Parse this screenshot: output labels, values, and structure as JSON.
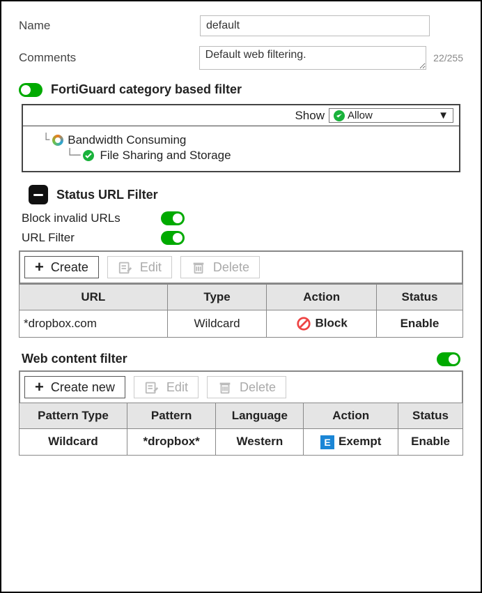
{
  "form": {
    "name_label": "Name",
    "name_value": "default",
    "comments_label": "Comments",
    "comments_value": "Default web filtering.",
    "comments_counter": "22/255"
  },
  "fortiguard": {
    "title": "FortiGuard category based filter",
    "show_label": "Show",
    "show_selected": "Allow",
    "tree_parent": "Bandwidth Consuming",
    "tree_child": "File Sharing and Storage"
  },
  "status_url": {
    "title": "Status URL Filter",
    "block_invalid_label": "Block invalid URLs",
    "url_filter_label": "URL Filter"
  },
  "url_toolbar": {
    "create": "Create",
    "edit": "Edit",
    "delete": "Delete"
  },
  "url_table": {
    "headers": [
      "URL",
      "Type",
      "Action",
      "Status"
    ],
    "row": {
      "url": "*dropbox.com",
      "type": "Wildcard",
      "action": "Block",
      "status": "Enable"
    }
  },
  "web_content": {
    "title": "Web content filter",
    "create": "Create new",
    "edit": "Edit",
    "delete": "Delete"
  },
  "wc_table": {
    "headers": [
      "Pattern Type",
      "Pattern",
      "Language",
      "Action",
      "Status"
    ],
    "row": {
      "ptype": "Wildcard",
      "pattern": "*dropbox*",
      "lang": "Western",
      "action": "Exempt",
      "status": "Enable"
    }
  }
}
